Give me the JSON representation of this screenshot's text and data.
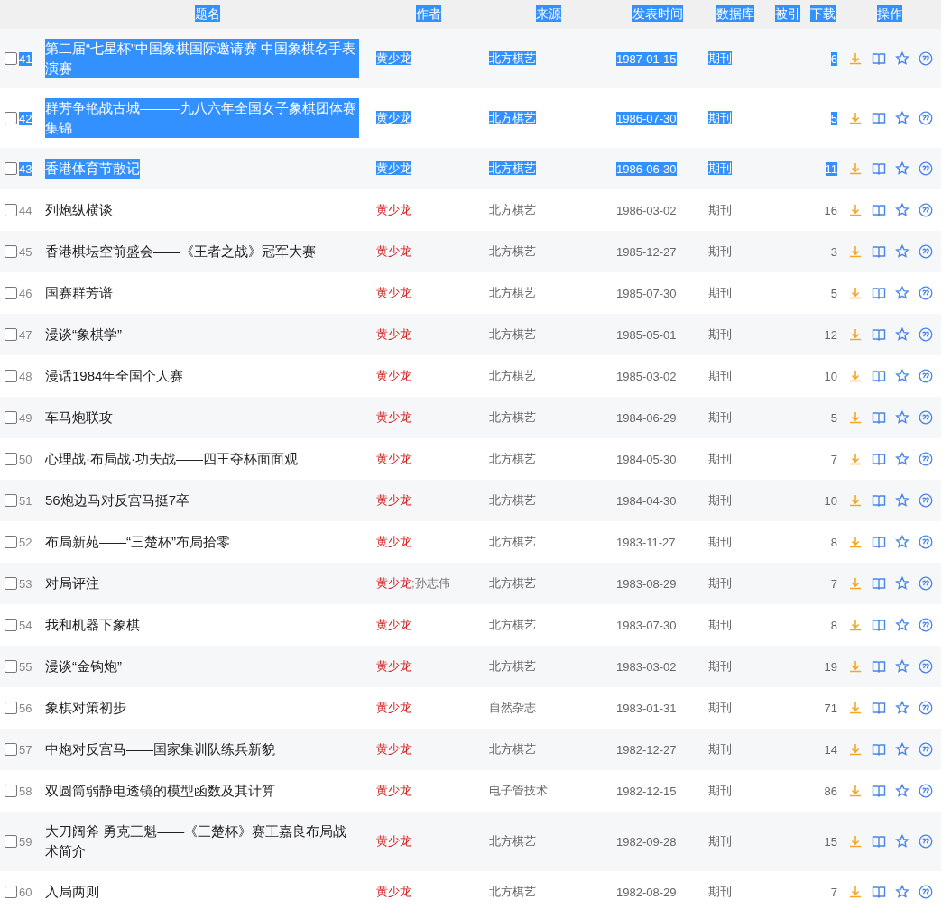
{
  "header": {
    "highlighted": true,
    "columns": [
      "题名",
      "作者",
      "来源",
      "发表时间",
      "数据库",
      "被引",
      "下载",
      "操作"
    ]
  },
  "author_separator": ";",
  "rows": [
    {
      "no": "41",
      "title": "第二届“七星杯”中国象棋国际邀请赛 中国象棋名手表演赛",
      "authors": [
        {
          "name": "黄少龙",
          "linked": true
        }
      ],
      "source": "北方棋艺",
      "date": "1987-01-15",
      "database": "期刊",
      "downloads": "6",
      "checked": false,
      "highlighted": true
    },
    {
      "no": "42",
      "title": "群芳争艳战古城———九八六年全国女子象棋团体赛集锦",
      "authors": [
        {
          "name": "黄少龙",
          "linked": true
        }
      ],
      "source": "北方棋艺",
      "date": "1986-07-30",
      "database": "期刊",
      "downloads": "5",
      "checked": false,
      "highlighted": true
    },
    {
      "no": "43",
      "title": "香港体育节散记",
      "authors": [
        {
          "name": "黄少龙",
          "linked": true
        }
      ],
      "source": "北方棋艺",
      "date": "1986-06-30",
      "database": "期刊",
      "downloads": "11",
      "checked": false,
      "highlighted": true
    },
    {
      "no": "44",
      "title": "列炮纵横谈",
      "authors": [
        {
          "name": "黄少龙",
          "linked": true
        }
      ],
      "source": "北方棋艺",
      "date": "1986-03-02",
      "database": "期刊",
      "downloads": "16",
      "checked": false,
      "highlighted": false
    },
    {
      "no": "45",
      "title": "香港棋坛空前盛会——《王者之战》冠军大赛",
      "authors": [
        {
          "name": "黄少龙",
          "linked": true
        }
      ],
      "source": "北方棋艺",
      "date": "1985-12-27",
      "database": "期刊",
      "downloads": "3",
      "checked": false,
      "highlighted": false
    },
    {
      "no": "46",
      "title": "国赛群芳谱",
      "authors": [
        {
          "name": "黄少龙",
          "linked": true
        }
      ],
      "source": "北方棋艺",
      "date": "1985-07-30",
      "database": "期刊",
      "downloads": "5",
      "checked": false,
      "highlighted": false
    },
    {
      "no": "47",
      "title": "漫谈“象棋学”",
      "authors": [
        {
          "name": "黄少龙",
          "linked": true
        }
      ],
      "source": "北方棋艺",
      "date": "1985-05-01",
      "database": "期刊",
      "downloads": "12",
      "checked": false,
      "highlighted": false
    },
    {
      "no": "48",
      "title": "漫话1984年全国个人赛",
      "authors": [
        {
          "name": "黄少龙",
          "linked": true
        }
      ],
      "source": "北方棋艺",
      "date": "1985-03-02",
      "database": "期刊",
      "downloads": "10",
      "checked": false,
      "highlighted": false
    },
    {
      "no": "49",
      "title": "车马炮联攻",
      "authors": [
        {
          "name": "黄少龙",
          "linked": true
        }
      ],
      "source": "北方棋艺",
      "date": "1984-06-29",
      "database": "期刊",
      "downloads": "5",
      "checked": false,
      "highlighted": false
    },
    {
      "no": "50",
      "title": "心理战·布局战·功夫战——四王夺杯面面观",
      "authors": [
        {
          "name": "黄少龙",
          "linked": true
        }
      ],
      "source": "北方棋艺",
      "date": "1984-05-30",
      "database": "期刊",
      "downloads": "7",
      "checked": false,
      "highlighted": false
    },
    {
      "no": "51",
      "title": "56炮边马对反宫马挺7卒",
      "authors": [
        {
          "name": "黄少龙",
          "linked": true
        }
      ],
      "source": "北方棋艺",
      "date": "1984-04-30",
      "database": "期刊",
      "downloads": "10",
      "checked": false,
      "highlighted": false
    },
    {
      "no": "52",
      "title": "布局新苑——“三楚杯”布局拾零",
      "authors": [
        {
          "name": "黄少龙",
          "linked": true
        }
      ],
      "source": "北方棋艺",
      "date": "1983-11-27",
      "database": "期刊",
      "downloads": "8",
      "checked": false,
      "highlighted": false
    },
    {
      "no": "53",
      "title": "对局评注",
      "authors": [
        {
          "name": "黄少龙",
          "linked": true
        },
        {
          "name": "孙志伟",
          "linked": false
        }
      ],
      "source": "北方棋艺",
      "date": "1983-08-29",
      "database": "期刊",
      "downloads": "7",
      "checked": false,
      "highlighted": false
    },
    {
      "no": "54",
      "title": "我和机器下象棋",
      "authors": [
        {
          "name": "黄少龙",
          "linked": true
        }
      ],
      "source": "北方棋艺",
      "date": "1983-07-30",
      "database": "期刊",
      "downloads": "8",
      "checked": false,
      "highlighted": false
    },
    {
      "no": "55",
      "title": "漫谈“金钩炮”",
      "authors": [
        {
          "name": "黄少龙",
          "linked": true
        }
      ],
      "source": "北方棋艺",
      "date": "1983-03-02",
      "database": "期刊",
      "downloads": "19",
      "checked": false,
      "highlighted": false
    },
    {
      "no": "56",
      "title": "象棋对策初步",
      "authors": [
        {
          "name": "黄少龙",
          "linked": true
        }
      ],
      "source": "自然杂志",
      "date": "1983-01-31",
      "database": "期刊",
      "downloads": "71",
      "checked": false,
      "highlighted": false
    },
    {
      "no": "57",
      "title": "中炮对反宫马——国家集训队练兵新貌",
      "authors": [
        {
          "name": "黄少龙",
          "linked": true
        }
      ],
      "source": "北方棋艺",
      "date": "1982-12-27",
      "database": "期刊",
      "downloads": "14",
      "checked": false,
      "highlighted": false
    },
    {
      "no": "58",
      "title": "双圆筒弱静电透镜的模型函数及其计算",
      "authors": [
        {
          "name": "黄少龙",
          "linked": true
        }
      ],
      "source": "电子管技术",
      "date": "1982-12-15",
      "database": "期刊",
      "downloads": "86",
      "checked": false,
      "highlighted": false
    },
    {
      "no": "59",
      "title": "大刀阔斧 勇克三魁——《三楚杯》赛王嘉良布局战术简介",
      "authors": [
        {
          "name": "黄少龙",
          "linked": true
        }
      ],
      "source": "北方棋艺",
      "date": "1982-09-28",
      "database": "期刊",
      "downloads": "15",
      "checked": false,
      "highlighted": false
    },
    {
      "no": "60",
      "title": "入局两则",
      "authors": [
        {
          "name": "黄少龙",
          "linked": true
        }
      ],
      "source": "北方棋艺",
      "date": "1982-08-29",
      "database": "期刊",
      "downloads": "7",
      "checked": false,
      "highlighted": false
    }
  ]
}
